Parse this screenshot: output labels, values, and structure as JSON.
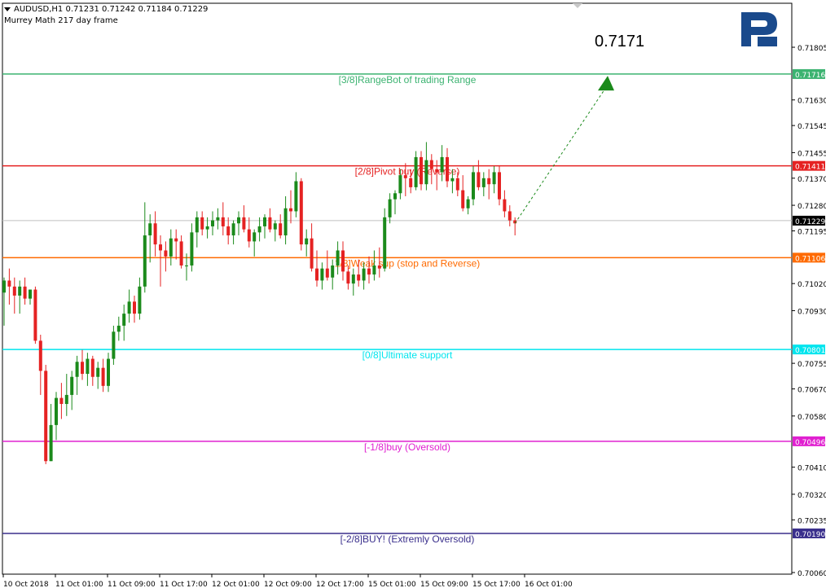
{
  "header": {
    "symbol_line": "AUDUSD,H1  0.71231 0.71242 0.71184 0.71229",
    "indicator_line": "Murrey Math 217 day frame"
  },
  "target_label": "0.7171",
  "logo": {
    "icon": "roboforex-logo-icon",
    "color": "#1a4a8c"
  },
  "colors": {
    "bull": "#1b8a1b",
    "bear": "#e52222",
    "range_bot": "#3cb371",
    "pivot": "#e52222",
    "weak": "#ff6a00",
    "ultimate": "#00e5ee",
    "oversold": "#e020d0",
    "extreme": "#3a2f8c",
    "current": "#c0c0c0"
  },
  "chart_data": {
    "type": "candlestick",
    "title": "AUDUSD,H1",
    "ylim": [
      0.7006,
      0.7187
    ],
    "y_ticks": [
      "0.71805",
      "0.71630",
      "0.71545",
      "0.71455",
      "0.71370",
      "0.71280",
      "0.71195",
      "0.71020",
      "0.70930",
      "0.70755",
      "0.70670",
      "0.70580",
      "0.70410",
      "0.70320",
      "0.70235",
      "0.70060"
    ],
    "x_ticks": [
      "10 Oct 2018",
      "11 Oct 01:00",
      "11 Oct 09:00",
      "11 Oct 17:00",
      "12 Oct 01:00",
      "12 Oct 09:00",
      "12 Oct 17:00",
      "15 Oct 01:00",
      "15 Oct 09:00",
      "15 Oct 17:00",
      "16 Oct 01:00"
    ],
    "levels": [
      {
        "label": "[3/8]RangeBot of trading Range",
        "price": 0.71716,
        "tag": "0.71716",
        "color_key": "range_bot"
      },
      {
        "label": "[2/8]Pivot buy (Reverse)",
        "price": 0.71411,
        "tag": "0.71411",
        "color_key": "pivot"
      },
      {
        "label": "1/8]Weak sup (stop and Reverse)",
        "price": 0.71106,
        "tag": "0.71106",
        "color_key": "weak"
      },
      {
        "label": "[0/8]Ultimate support",
        "price": 0.70801,
        "tag": "0.70801",
        "color_key": "ultimate"
      },
      {
        "label": "[-1/8]buy (Oversold)",
        "price": 0.70496,
        "tag": "0.70496",
        "color_key": "oversold"
      },
      {
        "label": "[-2/8]BUY! (Extremly Oversold)",
        "price": 0.7019,
        "tag": "0.70190",
        "color_key": "extreme"
      }
    ],
    "current_price": {
      "value": 0.71229,
      "tag": "0.71229"
    },
    "forecast": {
      "to": 0.7171
    },
    "candles": [
      [
        0.7099,
        0.7104,
        0.7088,
        0.7103
      ],
      [
        0.7103,
        0.7107,
        0.7095,
        0.7101
      ],
      [
        0.7101,
        0.7104,
        0.7092,
        0.7098
      ],
      [
        0.7098,
        0.7103,
        0.7092,
        0.7101
      ],
      [
        0.7101,
        0.7104,
        0.7095,
        0.7097
      ],
      [
        0.7097,
        0.71,
        0.7095,
        0.71
      ],
      [
        0.71,
        0.7101,
        0.7082,
        0.7083
      ],
      [
        0.7083,
        0.7085,
        0.7065,
        0.7073
      ],
      [
        0.7073,
        0.7075,
        0.7042,
        0.7043
      ],
      [
        0.7043,
        0.7062,
        0.7043,
        0.7055
      ],
      [
        0.7055,
        0.7066,
        0.705,
        0.7064
      ],
      [
        0.7064,
        0.7069,
        0.7057,
        0.7062
      ],
      [
        0.7062,
        0.7072,
        0.7058,
        0.7065
      ],
      [
        0.7065,
        0.7073,
        0.706,
        0.7071
      ],
      [
        0.7071,
        0.7078,
        0.7065,
        0.7076
      ],
      [
        0.7076,
        0.708,
        0.707,
        0.7072
      ],
      [
        0.7072,
        0.7079,
        0.7068,
        0.7077
      ],
      [
        0.7077,
        0.7078,
        0.7068,
        0.7071
      ],
      [
        0.7071,
        0.7076,
        0.7067,
        0.7074
      ],
      [
        0.7074,
        0.7077,
        0.7066,
        0.7068
      ],
      [
        0.7068,
        0.7079,
        0.7066,
        0.7077
      ],
      [
        0.7077,
        0.7088,
        0.7075,
        0.7086
      ],
      [
        0.7086,
        0.7091,
        0.7083,
        0.7088
      ],
      [
        0.7088,
        0.7095,
        0.7083,
        0.7092
      ],
      [
        0.7092,
        0.71,
        0.7089,
        0.7096
      ],
      [
        0.7096,
        0.7098,
        0.7089,
        0.7092
      ],
      [
        0.7092,
        0.7104,
        0.709,
        0.7101
      ],
      [
        0.7101,
        0.7129,
        0.7099,
        0.7118
      ],
      [
        0.7118,
        0.7125,
        0.7109,
        0.7122
      ],
      [
        0.7122,
        0.7126,
        0.7111,
        0.7115
      ],
      [
        0.7115,
        0.7118,
        0.7101,
        0.7113
      ],
      [
        0.7113,
        0.7116,
        0.7106,
        0.7111
      ],
      [
        0.7111,
        0.712,
        0.7108,
        0.7117
      ],
      [
        0.7117,
        0.712,
        0.711,
        0.7116
      ],
      [
        0.7116,
        0.7118,
        0.7107,
        0.7108
      ],
      [
        0.7108,
        0.7112,
        0.7103,
        0.7108
      ],
      [
        0.7108,
        0.7122,
        0.7106,
        0.7119
      ],
      [
        0.7119,
        0.7126,
        0.7114,
        0.7124
      ],
      [
        0.7124,
        0.7126,
        0.7118,
        0.712
      ],
      [
        0.712,
        0.7124,
        0.7117,
        0.7121
      ],
      [
        0.7121,
        0.7126,
        0.7118,
        0.7123
      ],
      [
        0.7123,
        0.7127,
        0.712,
        0.7124
      ],
      [
        0.7124,
        0.7129,
        0.7118,
        0.7121
      ],
      [
        0.7121,
        0.7124,
        0.7115,
        0.7118
      ],
      [
        0.7118,
        0.7123,
        0.7115,
        0.7122
      ],
      [
        0.7122,
        0.7126,
        0.7118,
        0.7124
      ],
      [
        0.7124,
        0.7128,
        0.7119,
        0.712
      ],
      [
        0.712,
        0.7124,
        0.7114,
        0.7116
      ],
      [
        0.7116,
        0.712,
        0.7111,
        0.7119
      ],
      [
        0.7119,
        0.7124,
        0.7116,
        0.7121
      ],
      [
        0.7121,
        0.7125,
        0.7117,
        0.7124
      ],
      [
        0.7124,
        0.7127,
        0.7119,
        0.712
      ],
      [
        0.712,
        0.7123,
        0.7116,
        0.7122
      ],
      [
        0.7122,
        0.7125,
        0.7117,
        0.7118
      ],
      [
        0.7118,
        0.7131,
        0.7115,
        0.7127
      ],
      [
        0.7127,
        0.7133,
        0.7122,
        0.7126
      ],
      [
        0.7126,
        0.7139,
        0.7124,
        0.7136
      ],
      [
        0.7136,
        0.7137,
        0.7113,
        0.7115
      ],
      [
        0.7115,
        0.712,
        0.7111,
        0.7117
      ],
      [
        0.7117,
        0.7122,
        0.7106,
        0.7107
      ],
      [
        0.7107,
        0.7113,
        0.7101,
        0.7103
      ],
      [
        0.7103,
        0.7109,
        0.71,
        0.7107
      ],
      [
        0.7107,
        0.7113,
        0.7103,
        0.7104
      ],
      [
        0.7104,
        0.711,
        0.71,
        0.7108
      ],
      [
        0.7108,
        0.7116,
        0.7105,
        0.7113
      ],
      [
        0.7113,
        0.7116,
        0.7103,
        0.7106
      ],
      [
        0.7106,
        0.7108,
        0.71,
        0.7102
      ],
      [
        0.7102,
        0.7107,
        0.7098,
        0.7105
      ],
      [
        0.7105,
        0.711,
        0.7101,
        0.7103
      ],
      [
        0.7103,
        0.7109,
        0.71,
        0.7107
      ],
      [
        0.7107,
        0.7111,
        0.7102,
        0.7105
      ],
      [
        0.7105,
        0.7113,
        0.7103,
        0.7108
      ],
      [
        0.7108,
        0.7114,
        0.7104,
        0.7107
      ],
      [
        0.7107,
        0.7127,
        0.7106,
        0.7124
      ],
      [
        0.7124,
        0.7132,
        0.7122,
        0.713
      ],
      [
        0.713,
        0.7133,
        0.7125,
        0.7132
      ],
      [
        0.7132,
        0.714,
        0.713,
        0.7138
      ],
      [
        0.7138,
        0.7142,
        0.7131,
        0.7137
      ],
      [
        0.7137,
        0.714,
        0.7132,
        0.7134
      ],
      [
        0.7134,
        0.7146,
        0.7133,
        0.7144
      ],
      [
        0.7144,
        0.7146,
        0.7133,
        0.7135
      ],
      [
        0.7135,
        0.7149,
        0.7133,
        0.7143
      ],
      [
        0.7143,
        0.7145,
        0.7135,
        0.714
      ],
      [
        0.714,
        0.7143,
        0.7133,
        0.7139
      ],
      [
        0.7139,
        0.7148,
        0.7136,
        0.7144
      ],
      [
        0.7144,
        0.7147,
        0.7134,
        0.7136
      ],
      [
        0.7136,
        0.714,
        0.7132,
        0.7137
      ],
      [
        0.7137,
        0.7139,
        0.7131,
        0.7133
      ],
      [
        0.7133,
        0.7138,
        0.7126,
        0.7127
      ],
      [
        0.7127,
        0.7131,
        0.7125,
        0.713
      ],
      [
        0.713,
        0.7141,
        0.7128,
        0.7139
      ],
      [
        0.7139,
        0.7143,
        0.7133,
        0.7134
      ],
      [
        0.7134,
        0.7139,
        0.7131,
        0.7137
      ],
      [
        0.7137,
        0.714,
        0.713,
        0.7135
      ],
      [
        0.7135,
        0.7141,
        0.7132,
        0.7139
      ],
      [
        0.7139,
        0.7141,
        0.7128,
        0.713
      ],
      [
        0.713,
        0.7133,
        0.7124,
        0.7126
      ],
      [
        0.7126,
        0.7128,
        0.7121,
        0.7123
      ],
      [
        0.7123,
        0.7124,
        0.7118,
        0.7122
      ]
    ]
  }
}
